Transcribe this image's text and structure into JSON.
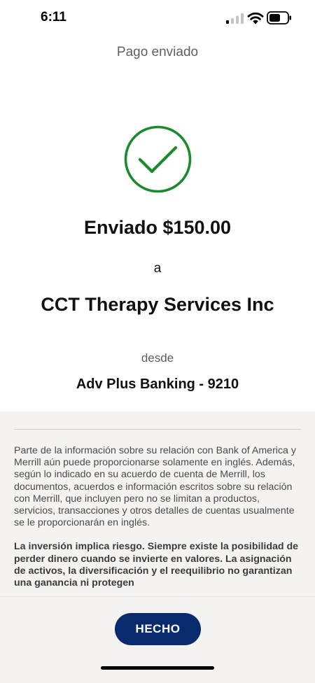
{
  "status_bar": {
    "time": "6:11",
    "icons": [
      "signal-icon",
      "wifi-icon",
      "battery-icon"
    ]
  },
  "header": {
    "title": "Pago enviado"
  },
  "confirmation": {
    "icon": "check-circle-icon",
    "icon_color": "#1a8a2e",
    "amount_line": "Enviado $150.00",
    "to_label": "a",
    "payee": "CCT Therapy Services Inc",
    "from_label": "desde",
    "account": "Adv Plus Banking - 9210"
  },
  "disclaimer": {
    "paragraph_1": "Parte de la información sobre su relación con Bank of America y Merrill aún puede proporcionarse solamente en inglés. Además, según lo indicado en su acuerdo de cuenta de Merrill, los documentos, acuerdos e información escritos sobre su relación con Merrill, que incluyen pero no se limitan a productos, servicios, transacciones y otros detalles de cuentas usualmente se le proporcionarán en inglés.",
    "paragraph_2": "La inversión implica riesgo. Siempre existe la posibilidad de perder dinero cuando se invierte en valores. La asignación de activos, la diversificación y el reequilibrio no garantizan una ganancia ni protegen"
  },
  "actions": {
    "done_label": "HECHO",
    "done_color": "#0a2a6e"
  }
}
